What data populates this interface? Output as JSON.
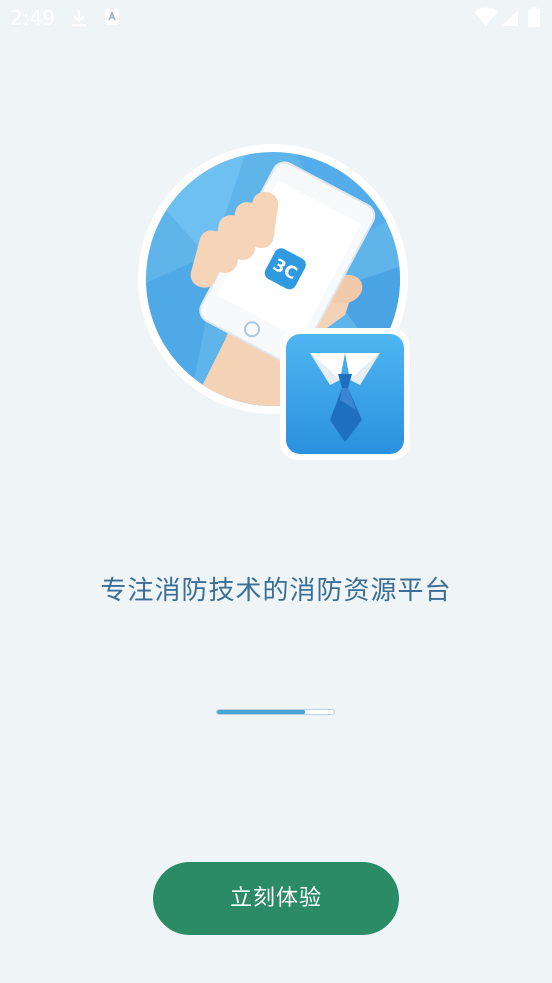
{
  "status_bar": {
    "time": "2:49",
    "icons": [
      "download-icon",
      "notification-icon",
      "wifi-icon",
      "signal-icon",
      "battery-icon"
    ]
  },
  "hero": {
    "logo_text": "3C",
    "colors": {
      "circle": "#5eb6ec",
      "app_icon": "#3aa4ea",
      "tie": "#1f6fc0"
    }
  },
  "tagline": "专注消防技术的消防资源平台",
  "progress": {
    "percent": 75,
    "fill_color": "#4aa4d8"
  },
  "cta": {
    "label": "立刻体验",
    "color": "#2b8b67"
  }
}
